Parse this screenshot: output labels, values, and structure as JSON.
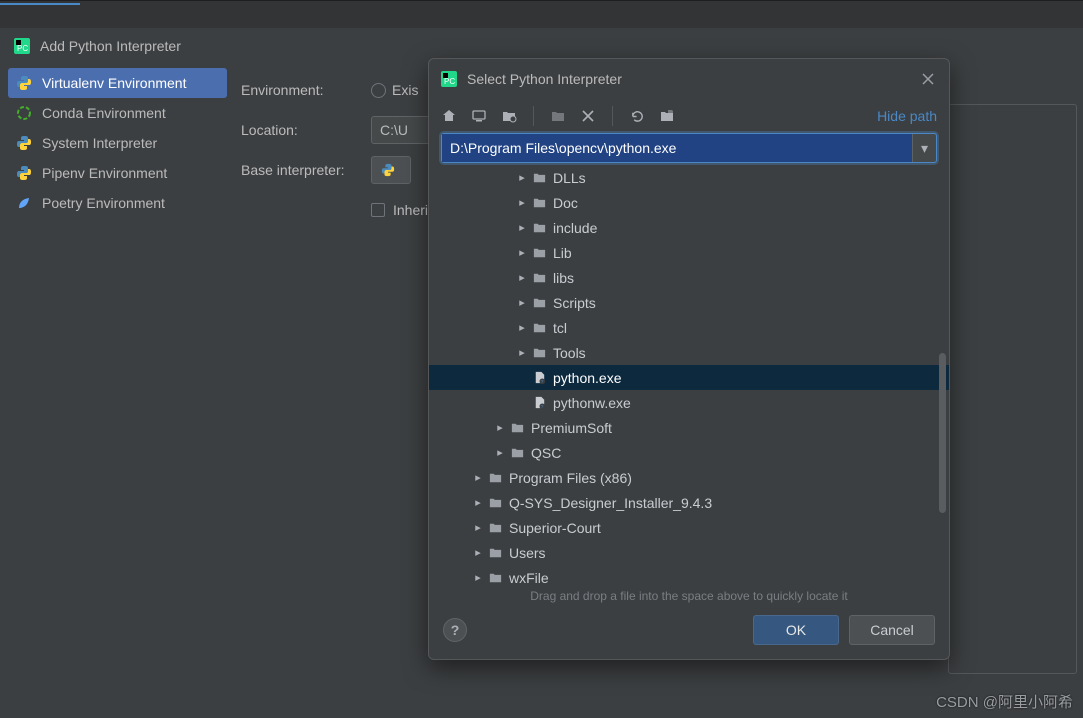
{
  "outerDialog": {
    "title": "Add Python Interpreter"
  },
  "sidebar": {
    "items": [
      {
        "label": "Virtualenv Environment",
        "icon": "python"
      },
      {
        "label": "Conda Environment",
        "icon": "conda"
      },
      {
        "label": "System Interpreter",
        "icon": "python"
      },
      {
        "label": "Pipenv Environment",
        "icon": "python"
      },
      {
        "label": "Poetry Environment",
        "icon": "poetry"
      }
    ],
    "selectedIndex": 0
  },
  "form": {
    "environmentLabel": "Environment:",
    "existingRadio": "Exis",
    "locationLabel": "Location:",
    "locationValue": "C:\\U",
    "baseLabel": "Base interpreter:",
    "baseIcon": "python",
    "baseValue": "",
    "inheritLabel": "Inherit global site-p"
  },
  "innerDialog": {
    "title": "Select Python Interpreter",
    "hidePath": "Hide path",
    "pathValue": "D:\\Program Files\\opencv\\python.exe",
    "hint": "Drag and drop a file into the space above to quickly locate it",
    "okLabel": "OK",
    "cancelLabel": "Cancel"
  },
  "tree": [
    {
      "indent": 3,
      "arrow": "closed",
      "type": "folder",
      "name": "DLLs"
    },
    {
      "indent": 3,
      "arrow": "closed",
      "type": "folder",
      "name": "Doc"
    },
    {
      "indent": 3,
      "arrow": "closed",
      "type": "folder",
      "name": "include"
    },
    {
      "indent": 3,
      "arrow": "closed",
      "type": "folder",
      "name": "Lib"
    },
    {
      "indent": 3,
      "arrow": "closed",
      "type": "folder",
      "name": "libs"
    },
    {
      "indent": 3,
      "arrow": "closed",
      "type": "folder",
      "name": "Scripts"
    },
    {
      "indent": 3,
      "arrow": "closed",
      "type": "folder",
      "name": "tcl"
    },
    {
      "indent": 3,
      "arrow": "closed",
      "type": "folder",
      "name": "Tools"
    },
    {
      "indent": 3,
      "arrow": "none",
      "type": "file",
      "name": "python.exe",
      "selected": true
    },
    {
      "indent": 3,
      "arrow": "none",
      "type": "file",
      "name": "pythonw.exe"
    },
    {
      "indent": 2,
      "arrow": "closed",
      "type": "folder",
      "name": "PremiumSoft"
    },
    {
      "indent": 2,
      "arrow": "closed",
      "type": "folder",
      "name": "QSC"
    },
    {
      "indent": 1,
      "arrow": "closed",
      "type": "folder",
      "name": "Program Files (x86)"
    },
    {
      "indent": 1,
      "arrow": "closed",
      "type": "folder",
      "name": "Q-SYS_Designer_Installer_9.4.3"
    },
    {
      "indent": 1,
      "arrow": "closed",
      "type": "folder",
      "name": "Superior-Court"
    },
    {
      "indent": 1,
      "arrow": "closed",
      "type": "folder",
      "name": "Users"
    },
    {
      "indent": 1,
      "arrow": "closed",
      "type": "folder",
      "name": "wxFile"
    }
  ],
  "watermark": "CSDN @阿里小阿希"
}
